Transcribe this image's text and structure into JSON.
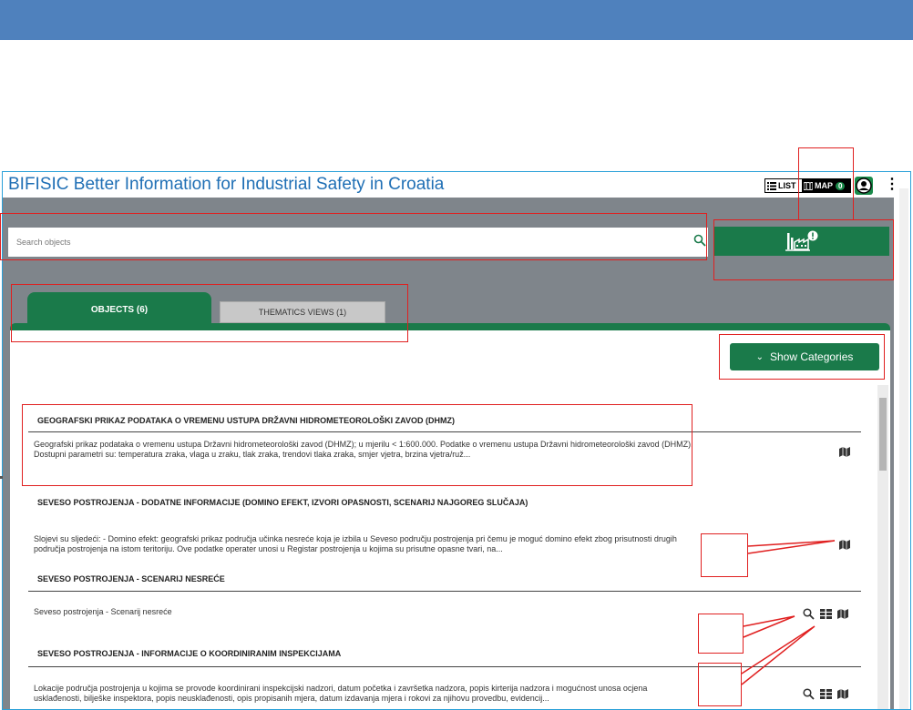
{
  "app": {
    "title": "BIFISIC Better Information for Industrial Safety in Croatia",
    "list_label": "LIST",
    "map_label": "MAP",
    "map_count": "0",
    "user_icon": "user-icon",
    "menu_icon": "kebab-menu-icon"
  },
  "search": {
    "placeholder": "Search objects",
    "icon": "search-icon"
  },
  "alert_button": {
    "icon": "factory-alert-icon"
  },
  "tabs": [
    {
      "label": "OBJECTS (6)",
      "active": true
    },
    {
      "label": "THEMATICS VIEWS (1)",
      "active": false
    }
  ],
  "categories_button": {
    "label": "Show Categories",
    "icon": "chevron-down-icon"
  },
  "objects": [
    {
      "title": "GEOGRAFSKI PRIKAZ PODATAKA O VREMENU USTUPA DRŽAVNI HIDROMETEOROLOŠKI ZAVOD (DHMZ)",
      "description": "Geografski prikaz podataka o vremenu ustupa Državni hidrometeorološki zavod (DHMZ); u mjerilu < 1:600.000. Podatke o vremenu ustupa Državni hidrometeorološki zavod (DHMZ). Dostupni parametri su: temperatura zraka, vlaga u zraku, tlak zraka, trendovi tlaka zraka, smjer vjetra, brzina vjetra/ruž...",
      "icons": [
        "map-icon"
      ]
    },
    {
      "title": "SEVESO POSTROJENJA - DODATNE INFORMACIJE (DOMINO EFEKT, IZVORI OPASNOSTI, SCENARIJ NAJGOREG SLUČAJA)",
      "description": "Slojevi su sljedeći: - Domino efekt: geografski prikaz područja učinka nesreće koja je izbila u Seveso području postrojenja pri čemu je moguć domino efekt zbog prisutnosti drugih područja postrojenja na istom teritoriju. Ove podatke operater unosi u Registar postrojenja u kojima su prisutne opasne tvari, na...",
      "icons": [
        "map-icon"
      ]
    },
    {
      "title": "SEVESO POSTROJENJA - SCENARIJ NESREĆE",
      "description": "Seveso postrojenja - Scenarij nesreće",
      "icons": [
        "search-icon",
        "table-icon",
        "map-icon"
      ]
    },
    {
      "title": "SEVESO POSTROJENJA - INFORMACIJE O KOORDINIRANIM INSPEKCIJAMA",
      "description": "Lokacije područja postrojenja u kojima se provode koordinirani inspekcijski nadzori, datum početka i završetka nadzora, popis kirterija nadzora i mogućnost unosa ocjena usklađenosti, bilješke inspektora, popis neusklađenosti, opis propisanih mjera, datum izdavanja mjera i rokovi za njihovu provedbu, evidencij...",
      "icons": [
        "search-icon",
        "table-icon",
        "map-icon"
      ]
    }
  ],
  "annotation_color": "#e02020",
  "accent_color": "#1a7a4a",
  "header_color": "#4f81bd"
}
